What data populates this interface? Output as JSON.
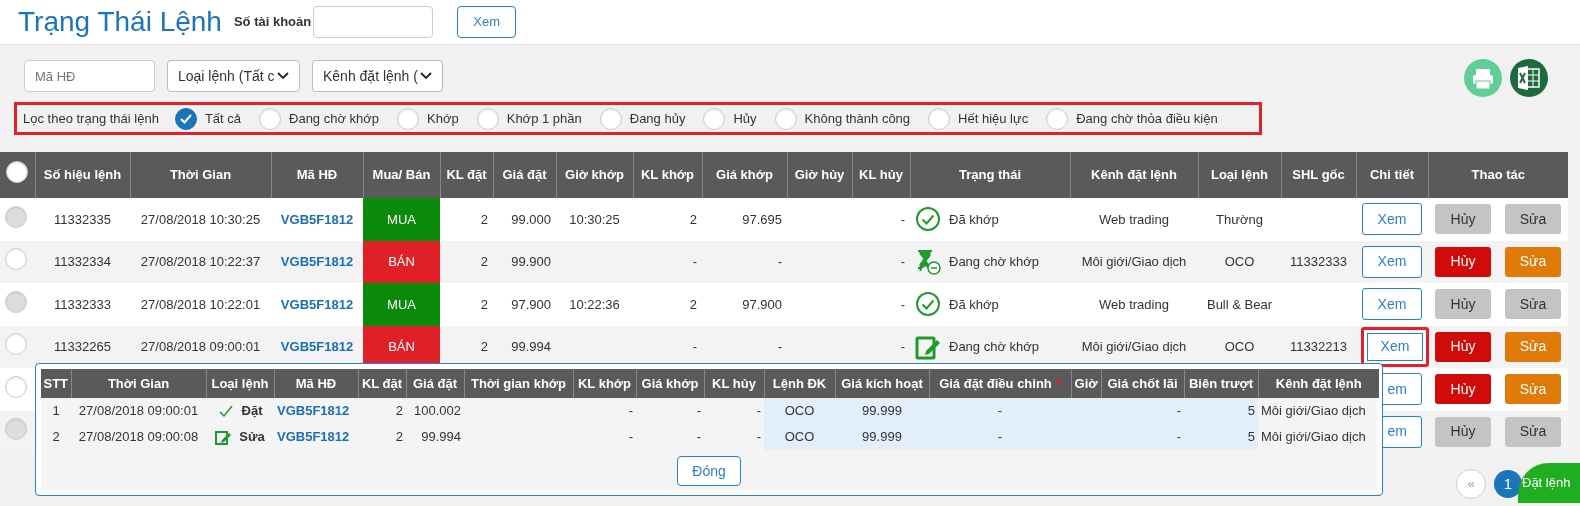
{
  "header": {
    "title": "Trạng Thái Lệnh",
    "account_label": "Số tài khoản",
    "view_button": "Xem"
  },
  "filters": {
    "contract_placeholder": "Mã HĐ",
    "order_type": "Loại lệnh (Tất c",
    "channel": "Kênh đặt lệnh ("
  },
  "status_filter": {
    "label": "Lọc theo trạng thái lệnh",
    "options": [
      {
        "label": "Tất cả",
        "selected": true
      },
      {
        "label": "Đang chờ khớp",
        "selected": false
      },
      {
        "label": "Khớp",
        "selected": false
      },
      {
        "label": "Khớp 1 phần",
        "selected": false
      },
      {
        "label": "Đang hủy",
        "selected": false
      },
      {
        "label": "Hủy",
        "selected": false
      },
      {
        "label": "Không thành công",
        "selected": false
      },
      {
        "label": "Hết hiệu lực",
        "selected": false
      },
      {
        "label": "Đang chờ thỏa điều kiện",
        "selected": false
      }
    ]
  },
  "orders_table": {
    "select_all": {
      "selected": false
    },
    "columns": [
      "Số hiệu lệnh",
      "Thời Gian",
      "Mã HĐ",
      "Mua/ Bán",
      "KL đặt",
      "Giá đặt",
      "Giờ khớp",
      "KL khớp",
      "Giá khớp",
      "Giờ hủy",
      "KL hủy",
      "Trạng thái",
      "Kênh đặt lệnh",
      "Loại lệnh",
      "SHL gốc",
      "Chi tiết",
      "Thao tác"
    ],
    "rows": [
      {
        "disabled": true,
        "order_no": "11332335",
        "time": "27/08/2018 10:30:25",
        "contract": "VGB5F1812",
        "side": {
          "kind": "buy",
          "label": "MUA"
        },
        "qty": "2",
        "price": "99.000",
        "match_time": "10:30:25",
        "match_qty": "2",
        "match_price": "97.695",
        "cancel_qty": "-",
        "status": {
          "kind": "matched",
          "label": "Đã khớp"
        },
        "channel": "Web trading",
        "order_type": "Thường",
        "details": "Xem",
        "highlighted": false,
        "cancel": "Hủy",
        "edit": "Sửa",
        "actions_enabled": false
      },
      {
        "disabled": false,
        "order_no": "11332334",
        "time": "27/08/2018 10:22:37",
        "contract": "VGB5F1812",
        "side": {
          "kind": "sell",
          "label": "BÁN"
        },
        "qty": "2",
        "price": "99.900",
        "match_qty": "-",
        "match_price": "-",
        "cancel_qty": "-",
        "status": {
          "kind": "pending",
          "label": "Đang chờ khớp"
        },
        "channel": "Môi giới/Giao dịch",
        "order_type": "OCO",
        "origin": "11332333",
        "details": "Xem",
        "highlighted": false,
        "cancel": "Hủy",
        "edit": "Sửa",
        "actions_enabled": true
      },
      {
        "disabled": true,
        "order_no": "11332333",
        "time": "27/08/2018 10:22:01",
        "contract": "VGB5F1812",
        "side": {
          "kind": "buy",
          "label": "MUA"
        },
        "qty": "2",
        "price": "97.900",
        "match_time": "10:22:36",
        "match_qty": "2",
        "match_price": "97.900",
        "cancel_qty": "-",
        "status": {
          "kind": "matched",
          "label": "Đã khớp"
        },
        "channel": "Web trading",
        "order_type": "Bull & Bear",
        "details": "Xem",
        "highlighted": false,
        "cancel": "Hủy",
        "edit": "Sửa",
        "actions_enabled": false
      },
      {
        "disabled": false,
        "order_no": "11332265",
        "time": "27/08/2018 09:00:01",
        "contract": "VGB5F1812",
        "side": {
          "kind": "sell",
          "label": "BÁN"
        },
        "qty": "2",
        "price": "99.994",
        "match_qty": "-",
        "match_price": "-",
        "cancel_qty": "-",
        "status": {
          "kind": "modified",
          "label": "Đang chờ khớp"
        },
        "channel": "Môi giới/Giao dịch",
        "order_type": "OCO",
        "origin": "11332213",
        "details": "Xem",
        "highlighted": true,
        "cancel": "Hủy",
        "edit": "Sửa",
        "actions_enabled": true
      },
      {
        "disabled": false,
        "details": "em",
        "highlighted": false,
        "cancel": "Hủy",
        "edit": "Sửa",
        "actions_enabled": true
      },
      {
        "disabled": true,
        "details": "em",
        "highlighted": false,
        "cancel": "Hủy",
        "edit": "Sửa",
        "actions_enabled": false
      }
    ]
  },
  "history_popup": {
    "columns": [
      {
        "label": "STT"
      },
      {
        "label": "Thời Gian"
      },
      {
        "label": "Loại lệnh"
      },
      {
        "label": "Mã HĐ"
      },
      {
        "label": "KL đặt"
      },
      {
        "label": "Giá đặt"
      },
      {
        "label": "Thời gian khớp"
      },
      {
        "label": "KL khớp"
      },
      {
        "label": "Giá khớp"
      },
      {
        "label": "KL hủy"
      },
      {
        "label": "Lệnh ĐK"
      },
      {
        "label": "Giá kích hoạt"
      },
      {
        "label": "Giá đặt điều chỉnh",
        "mark": "*"
      },
      {
        "label": "Giờ"
      },
      {
        "label": "Giá chốt lãi"
      },
      {
        "label": "Biên trượt"
      },
      {
        "label": "Kênh đặt lệnh"
      }
    ],
    "rows": [
      {
        "no": "1",
        "time": "27/08/2018 09:00:01",
        "kind": "place",
        "type_label": "Đặt",
        "contract": "VGB5F1812",
        "qty": "2",
        "price": "100.002",
        "match_qty": "-",
        "match_price": "-",
        "cancel_qty": "-",
        "condition": "OCO",
        "trigger_price": "99.999",
        "adjusted_price": "-",
        "take_profit": "-",
        "slippage": "5",
        "channel": "Môi giới/Giao dịch"
      },
      {
        "no": "2",
        "time": "27/08/2018 09:00:08",
        "kind": "edit",
        "type_label": "Sửa",
        "contract": "VGB5F1812",
        "qty": "2",
        "price": "99.994",
        "match_qty": "-",
        "match_price": "-",
        "cancel_qty": "-",
        "condition": "OCO",
        "trigger_price": "99.999",
        "adjusted_price": "-",
        "take_profit": "-",
        "slippage": "5",
        "channel": "Môi giới/Giao dịch"
      }
    ],
    "close_button": "Đóng"
  },
  "pagination": {
    "prev": "«",
    "pages": [
      {
        "label": "1",
        "selected": true
      }
    ],
    "place_order": "Đặt lệnh"
  }
}
